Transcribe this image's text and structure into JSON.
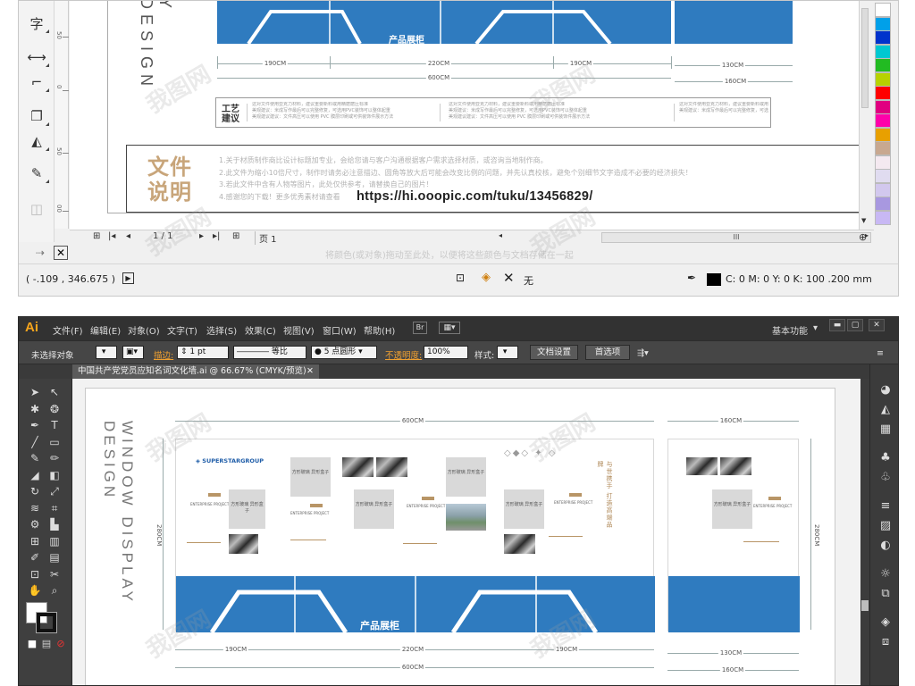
{
  "coreldraw": {
    "design_vertical_text": "Y DESIGN",
    "blue_panel_title": "产品展柜",
    "dimensions": {
      "d190_left": "190CM",
      "d220": "220CM",
      "d190_right": "190CM",
      "d600": "600CM",
      "d130": "130CM",
      "d160": "160CM"
    },
    "craft_box": {
      "title_line1": "工艺",
      "title_line2": "建议",
      "lines": [
        "这对文件使用亚克力材料，建议重要新料或用精磨磨压标准",
        "美观建议：米成写作最后可以完整修复，可选用PVC装饰可以整体起重",
        "美观建议建议：文件高压可以使用 PVC 膜层印刷或可供装饰件展示方法"
      ]
    },
    "doc_box": {
      "title_line1": "文件",
      "title_line2": "说明",
      "lines": [
        "1.关于材质制作商比设计标题加专业，会给您请与客户沟通根据客户需求选择材质，或咨询当地制作商。",
        "2.此文件为缩小10倍尺寸，制作时请务必注意描边、圆角等放大后可能会改变比例的问题，并先认真校核，避免个别细节文字造成不必要的经济损失！",
        "3.若此文件中含有人物等图片，此处仅供参考，请替换自己的图片！",
        "4.感谢您的下载！更多优秀素材请查看"
      ],
      "url": "https://hi.ooopic.com/tuku/13456829/"
    },
    "nav": {
      "page_counter": "1 / 1",
      "page_tab": "页 1"
    },
    "hint": "将颜色(或对象)拖动至此处，以便将这些颜色与文档存储在一起",
    "status": {
      "coordinates": "( -.109 , 346.675 )",
      "fill_none": "无",
      "color_info": "C: 0 M: 0 Y: 0 K: 100  .200 mm"
    },
    "palette": [
      "#ffffff",
      "#00a0e9",
      "#0033cc",
      "#00c8d0",
      "#22bb22",
      "#b8d200",
      "#ff0000",
      "#e00080",
      "#ff00aa",
      "#e8a000",
      "#c8a890",
      "#f4e9f0",
      "#e0dcf0",
      "#d2c8ee",
      "#a898e0",
      "#c8b8f4"
    ]
  },
  "illustrator": {
    "logo": "Ai",
    "menus": [
      "文件(F)",
      "编辑(E)",
      "对象(O)",
      "文字(T)",
      "选择(S)",
      "效果(C)",
      "视图(V)",
      "窗口(W)",
      "帮助(H)"
    ],
    "workspace": "基本功能",
    "control": {
      "selection": "未选择对象",
      "stroke_label": "描边:",
      "stroke_value": "1 pt",
      "stroke_style": "等比",
      "brush": "5 点圆形",
      "opacity_label": "不透明度:",
      "opacity_value": "100%",
      "style_label": "样式:",
      "doc_setup": "文档设置",
      "prefs": "首选项"
    },
    "doc_tab": "中国共产党党员应知名词文化墙.ai @ 66.67% (CMYK/预览)",
    "artboard": {
      "vertical_text": "WINDOW DISPLAY DESIGN",
      "dim_600": "600CM",
      "dim_160": "160CM",
      "dim_280_left": "280CM",
      "dim_280_right": "280CM",
      "dim_190_left": "190CM",
      "dim_220": "220CM",
      "dim_190_right": "190CM",
      "dim_600_bottom": "600CM",
      "dim_130": "130CM",
      "dim_160_bottom": "160CM",
      "brand": "SUPERSTARGROUP",
      "blue_title": "产品展柜",
      "placeholder_text": "方形玻璃\n异形盒子",
      "slogan": "与世携手 打造高端品牌",
      "enterprise": "ENTERPRISE\nPROJECT"
    }
  },
  "watermark": "我图网"
}
